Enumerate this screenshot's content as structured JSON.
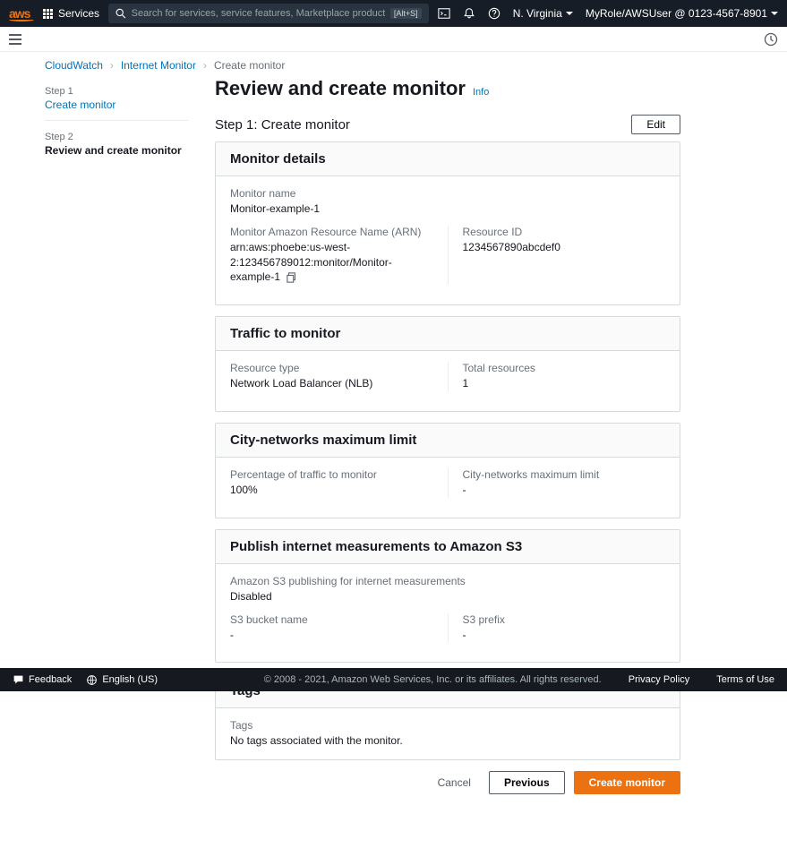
{
  "topnav": {
    "services": "Services",
    "search_placeholder": "Search for services, service features, Marketplace products, docs, and more",
    "search_kbd": "[Alt+S]",
    "region": "N. Virginia",
    "user": "MyRole/AWSUser @ 0123-4567-8901"
  },
  "breadcrumb": {
    "items": [
      "CloudWatch",
      "Internet Monitor",
      "Create monitor"
    ]
  },
  "steps": {
    "step1_label": "Step 1",
    "step1_title": "Create monitor",
    "step2_label": "Step 2",
    "step2_title": "Review and create monitor"
  },
  "page": {
    "title": "Review and create monitor",
    "info": "Info",
    "step_heading": "Step 1: Create monitor",
    "edit": "Edit"
  },
  "monitor_details": {
    "header": "Monitor details",
    "name_label": "Monitor name",
    "name_value": "Monitor-example-1",
    "arn_label": "Monitor Amazon Resource Name (ARN)",
    "arn_value": "arn:aws:phoebe:us-west-2:123456789012:monitor/Monitor-example-1",
    "resource_id_label": "Resource ID",
    "resource_id_value": "1234567890abcdef0"
  },
  "traffic": {
    "header": "Traffic to monitor",
    "type_label": "Resource type",
    "type_value": "Network Load Balancer (NLB)",
    "total_label": "Total resources",
    "total_value": "1"
  },
  "city": {
    "header": "City-networks maximum limit",
    "pct_label": "Percentage of traffic to monitor",
    "pct_value": "100%",
    "limit_label": "City-networks maximum limit",
    "limit_value": "-"
  },
  "s3": {
    "header": "Publish internet measurements to Amazon S3",
    "publishing_label": "Amazon S3 publishing for internet measurements",
    "publishing_value": "Disabled",
    "bucket_label": "S3 bucket name",
    "bucket_value": "-",
    "prefix_label": "S3 prefix",
    "prefix_value": "-"
  },
  "tags": {
    "header": "Tags",
    "label": "Tags",
    "value": "No tags associated with the monitor."
  },
  "actions": {
    "cancel": "Cancel",
    "previous": "Previous",
    "create": "Create monitor"
  },
  "footer": {
    "feedback": "Feedback",
    "language": "English (US)",
    "copy": "© 2008 - 2021, Amazon Web Services, Inc. or its affiliates. All rights reserved.",
    "privacy": "Privacy Policy",
    "terms": "Terms of Use"
  }
}
